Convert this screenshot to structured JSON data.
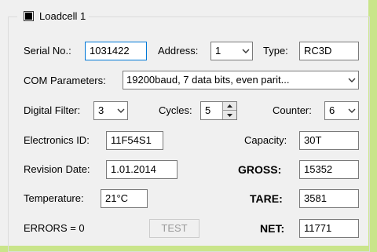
{
  "group": {
    "title": "Loadcell 1"
  },
  "serial": {
    "label": "Serial No.:",
    "value": "1031422"
  },
  "address": {
    "label": "Address:",
    "value": "1"
  },
  "type": {
    "label": "Type:",
    "value": "RC3D"
  },
  "com": {
    "label": "COM Parameters:",
    "value": "19200baud, 7 data bits, even parit..."
  },
  "filter": {
    "label": "Digital Filter:",
    "value": "3"
  },
  "cycles": {
    "label": "Cycles:",
    "value": "5"
  },
  "counter": {
    "label": "Counter:",
    "value": "6"
  },
  "electronics": {
    "label": "Electronics ID:",
    "value": "11F54S1"
  },
  "capacity": {
    "label": "Capacity:",
    "value": "30T"
  },
  "revision": {
    "label": "Revision Date:",
    "value": "1.01.2014"
  },
  "gross": {
    "label": "GROSS:",
    "value": "15352"
  },
  "temperature": {
    "label": "Temperature:",
    "value": "21°C"
  },
  "tare": {
    "label": "TARE:",
    "value": "3581"
  },
  "errors": {
    "label": "ERRORS = 0"
  },
  "test_button": {
    "label": "TEST"
  },
  "net": {
    "label": "NET:",
    "value": "11771"
  },
  "colors": {
    "background": "#f0f0f0",
    "outer": "#c9e58a",
    "focus_border": "#0078d7"
  },
  "icons": {
    "dropdown": "chevron-down-icon",
    "spin_up": "spin-up-icon",
    "spin_down": "spin-down-icon",
    "checkbox": "checkbox-icon"
  }
}
